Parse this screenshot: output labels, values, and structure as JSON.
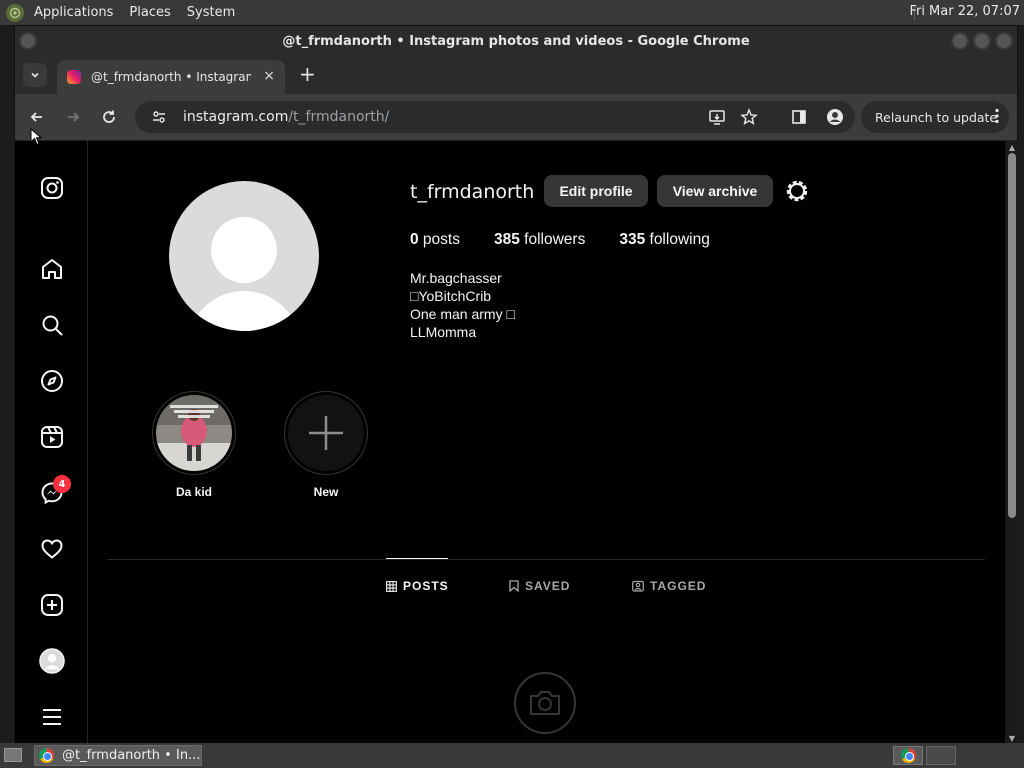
{
  "system_panel": {
    "menus": [
      "Applications",
      "Places",
      "System"
    ],
    "clock": "Fri Mar 22, 07:07"
  },
  "window": {
    "title": "@t_frmdanorth • Instagram photos and videos - Google Chrome"
  },
  "tab": {
    "title": "@t_frmdanorth • Instagram photos and videos",
    "close": "×",
    "new_tab": "+"
  },
  "toolbar": {
    "url_host": "instagram.com",
    "url_path": "/t_frmdanorth/",
    "relaunch_label": "Relaunch to update"
  },
  "profile": {
    "username": "t_frmdanorth",
    "edit_profile_label": "Edit profile",
    "view_archive_label": "View archive",
    "posts_count": "0",
    "posts_label": " posts",
    "followers_count": "385",
    "followers_label": " followers",
    "following_count": "335",
    "following_label": " following",
    "bio": [
      "Mr.bagchasser",
      "□YoBitchCrib",
      "One man army □",
      "LLMomma"
    ]
  },
  "highlights": [
    {
      "label": "Da kid"
    },
    {
      "label": "New"
    }
  ],
  "profile_tabs": [
    {
      "label": "POSTS",
      "icon": "grid-icon",
      "active": true
    },
    {
      "label": "SAVED",
      "icon": "bookmark-icon",
      "active": false
    },
    {
      "label": "TAGGED",
      "icon": "tagged-icon",
      "active": false
    }
  ],
  "sidebar": {
    "messages_badge": "4"
  },
  "taskbar": {
    "item_label": "@t_frmdanorth • In..."
  },
  "colors": {
    "page_bg": "#000000",
    "button_bg": "#363636",
    "badge": "#ff3040"
  }
}
